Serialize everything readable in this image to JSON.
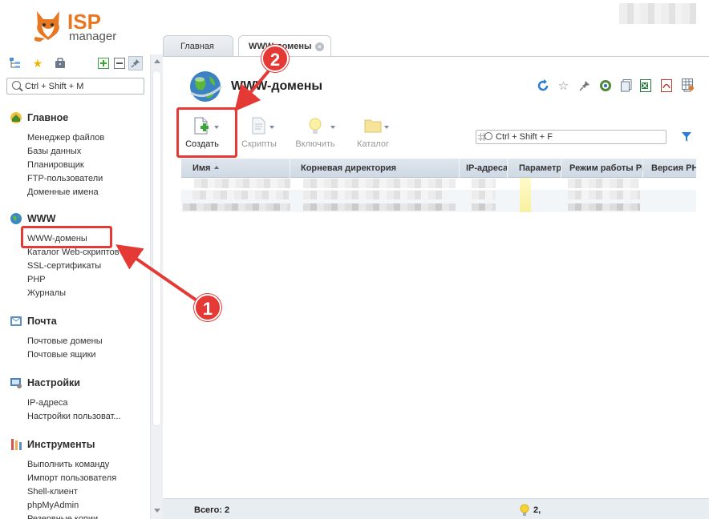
{
  "logo": {
    "brand": "ISP",
    "product": "manager"
  },
  "sidebar": {
    "search_placeholder": "Ctrl + Shift + M",
    "groups": [
      {
        "title": "Главное",
        "icon": "home-icon",
        "items": [
          "Менеджер файлов",
          "Базы данных",
          "Планировщик",
          "FTP-пользователи",
          "Доменные имена"
        ]
      },
      {
        "title": "WWW",
        "icon": "globe-icon",
        "items": [
          "WWW-домены",
          "Каталог Web-скриптов",
          "SSL-сертификаты",
          "PHP",
          "Журналы"
        ]
      },
      {
        "title": "Почта",
        "icon": "mail-icon",
        "items": [
          "Почтовые домены",
          "Почтовые ящики"
        ]
      },
      {
        "title": "Настройки",
        "icon": "settings-icon",
        "items": [
          "IP-адреса",
          "Настройки пользоват..."
        ]
      },
      {
        "title": "Инструменты",
        "icon": "tools-icon",
        "items": [
          "Выполнить команду",
          "Импорт пользователя",
          "Shell-клиент",
          "phpMyAdmin",
          "Резервные копии"
        ]
      }
    ]
  },
  "tabs": [
    {
      "label": "Главная"
    },
    {
      "label": "WWW-домены"
    }
  ],
  "page": {
    "title": "WWW-домены"
  },
  "toolbar": {
    "buttons": [
      {
        "label": "Создать",
        "enabled": true
      },
      {
        "label": "Скрипты",
        "enabled": false
      },
      {
        "label": "Включить",
        "enabled": false
      },
      {
        "label": "Каталог",
        "enabled": false
      }
    ],
    "search_placeholder": "Ctrl + Shift + F"
  },
  "table": {
    "columns": [
      "Имя",
      "Корневая директория",
      "IP-адреса",
      "Параметры",
      "Режим работы PHP",
      "Версия PHP"
    ],
    "row_count": 3
  },
  "footer": {
    "total": "Всего: 2",
    "count": "2,"
  },
  "annotations": {
    "step1": "1",
    "step2": "2",
    "color": "#e53935"
  }
}
